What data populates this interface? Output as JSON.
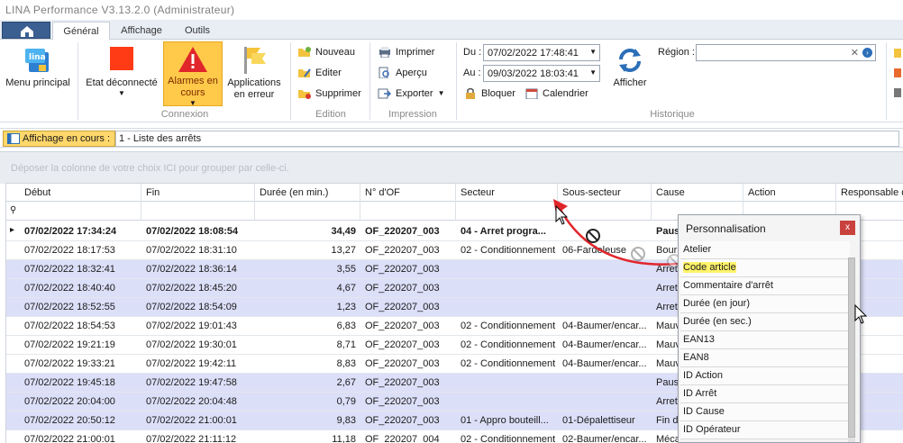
{
  "window": {
    "title": "LINA Performance  V3.13.2.0  (Administrateur)"
  },
  "tabs": [
    "Général",
    "Affichage",
    "Outils"
  ],
  "ribbon": {
    "menu_principal": "Menu principal",
    "etat": "Etat déconnecté",
    "alarmes": "Alarmes en cours",
    "applications": "Applications en erreur",
    "connexion_group": "Connexion",
    "nouveau": "Nouveau",
    "editer": "Editer",
    "supprimer": "Supprimer",
    "edition_group": "Edition",
    "imprimer": "Imprimer",
    "apercu": "Aperçu",
    "exporter": "Exporter",
    "impression_group": "Impression",
    "du_label": "Du :",
    "du_value": "07/02/2022 17:48:41",
    "au_label": "Au :",
    "au_value": "09/03/2022 18:03:41",
    "bloquer": "Bloquer",
    "calendrier": "Calendrier",
    "afficher": "Afficher",
    "region_label": "Région :",
    "region_value": "",
    "historique_group": "Historique"
  },
  "affichage": {
    "label": "Affichage en cours :",
    "value": "1 - Liste des arrêts"
  },
  "group_zone": "Déposer la colonne de votre choix ICI pour grouper par celle-ci.",
  "columns": [
    "Début",
    "Fin",
    "Durée (en min.)",
    "N° d'OF",
    "Secteur",
    "Sous-secteur",
    "Cause",
    "Action",
    "Responsable de"
  ],
  "rows": [
    [
      "07/02/2022 17:34:24",
      "07/02/2022 18:08:54",
      "34,49",
      "OF_220207_003",
      "04 - Arret progra...",
      "",
      "Paus",
      "",
      ""
    ],
    [
      "07/02/2022 18:17:53",
      "07/02/2022 18:31:10",
      "13,27",
      "OF_220207_003",
      "02 - Conditionnement",
      "06-Fardeleuse",
      "Bourra",
      "",
      ""
    ],
    [
      "07/02/2022 18:32:41",
      "07/02/2022 18:36:14",
      "3,55",
      "OF_220207_003",
      "",
      "",
      "Arret",
      "",
      ""
    ],
    [
      "07/02/2022 18:40:40",
      "07/02/2022 18:45:20",
      "4,67",
      "OF_220207_003",
      "",
      "",
      "Arret",
      "",
      ""
    ],
    [
      "07/02/2022 18:52:55",
      "07/02/2022 18:54:09",
      "1,23",
      "OF_220207_003",
      "",
      "",
      "Arret",
      "",
      ""
    ],
    [
      "07/02/2022 18:54:53",
      "07/02/2022 19:01:43",
      "6,83",
      "OF_220207_003",
      "02 - Conditionnement",
      "04-Baumer/encar...",
      "Mauva",
      "",
      ""
    ],
    [
      "07/02/2022 19:21:19",
      "07/02/2022 19:30:01",
      "8,71",
      "OF_220207_003",
      "02 - Conditionnement",
      "04-Baumer/encar...",
      "Mauva",
      "",
      ""
    ],
    [
      "07/02/2022 19:33:21",
      "07/02/2022 19:42:11",
      "8,83",
      "OF_220207_003",
      "02 - Conditionnement",
      "04-Baumer/encar...",
      "Mauva",
      "",
      ""
    ],
    [
      "07/02/2022 19:45:18",
      "07/02/2022 19:47:58",
      "2,67",
      "OF_220207_003",
      "",
      "",
      "Paus",
      "",
      ""
    ],
    [
      "07/02/2022 20:04:00",
      "07/02/2022 20:04:48",
      "0,79",
      "OF_220207_003",
      "",
      "",
      "Arret",
      "",
      ""
    ],
    [
      "07/02/2022 20:50:12",
      "07/02/2022 21:00:01",
      "9,83",
      "OF_220207_003",
      "01 - Appro bouteill...",
      "01-Dépalettiseur",
      "Fin de",
      "",
      ""
    ],
    [
      "07/02/2022 21:00:01",
      "07/02/2022 21:11:12",
      "11,18",
      "OF_220207_004",
      "02 - Conditionnement",
      "02-Baumer/encar...",
      "Méca",
      "",
      ""
    ]
  ],
  "panel": {
    "title": "Personnalisation",
    "close": "x",
    "items": [
      "Atelier",
      "Code article",
      "Commentaire d'arrêt",
      "Durée (en jour)",
      "Durée (en sec.)",
      "EAN13",
      "EAN8",
      "ID Action",
      "ID Arrêt",
      "ID Cause",
      "ID Opérateur"
    ],
    "highlighted": "Code article"
  },
  "colors": {
    "accent_red": "#e0262a",
    "alt_row": "#dcdff8",
    "highlight": "#ffd76b",
    "drag_arrow": "#e1262b"
  }
}
